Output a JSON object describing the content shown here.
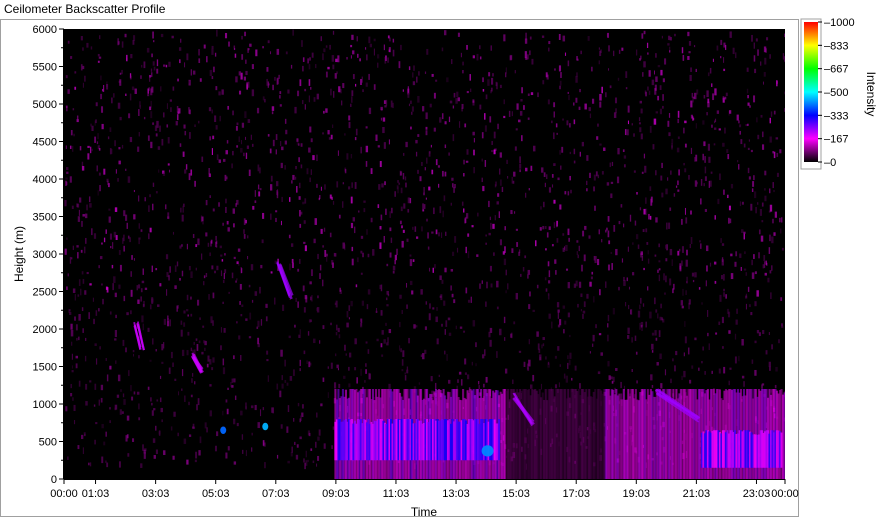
{
  "window": {
    "title": "Ceilometer Backscatter Profile"
  },
  "chart_data": {
    "type": "heatmap",
    "title": "Ceilometer Backscatter Profile",
    "xlabel": "Time",
    "ylabel": "Height (m)",
    "x_ticks": [
      "00:00",
      "01:03",
      "03:03",
      "05:03",
      "07:03",
      "09:03",
      "11:03",
      "13:03",
      "15:03",
      "17:03",
      "19:03",
      "21:03",
      "23:03",
      "00:00"
    ],
    "x_range_hours": [
      0,
      24
    ],
    "y_ticks": [
      "0",
      "500",
      "1000",
      "1500",
      "2000",
      "2500",
      "3000",
      "3500",
      "4000",
      "4500",
      "5000",
      "5500",
      "6000"
    ],
    "ylim": [
      0,
      6000
    ],
    "colorbar": {
      "label": "Intensity",
      "ticks": [
        "0",
        "167",
        "333",
        "500",
        "667",
        "833",
        "1000"
      ],
      "range": [
        0,
        1000
      ],
      "colors": [
        "#000000",
        "#ff00ff",
        "#0000ff",
        "#00ffff",
        "#00ff00",
        "#ffff00",
        "#ff0000"
      ]
    },
    "background_color": "#000000",
    "features": [
      {
        "name": "boundary layer",
        "t_start": 9.0,
        "t_end": 14.7,
        "h_low": 0,
        "h_high": 1200,
        "intensity": 220
      },
      {
        "name": "boundary layer",
        "t_start": 14.7,
        "t_end": 18.0,
        "h_low": 0,
        "h_high": 1200,
        "intensity": 60
      },
      {
        "name": "boundary layer",
        "t_start": 18.0,
        "t_end": 24.0,
        "h_low": 0,
        "h_high": 1200,
        "intensity": 200
      },
      {
        "name": "aerosol layer",
        "t_start": 9.0,
        "t_end": 14.5,
        "h_low": 250,
        "h_high": 800,
        "intensity": 300
      },
      {
        "name": "aerosol layer",
        "t_start": 21.2,
        "t_end": 23.9,
        "h_low": 150,
        "h_high": 650,
        "intensity": 280
      },
      {
        "name": "cloud",
        "t_start": 5.2,
        "t_end": 5.4,
        "h_low": 600,
        "h_high": 700,
        "intensity": 400
      },
      {
        "name": "cloud",
        "t_start": 6.6,
        "t_end": 6.8,
        "h_low": 650,
        "h_high": 750,
        "intensity": 450
      },
      {
        "name": "cloud",
        "t_start": 13.9,
        "t_end": 14.3,
        "h_low": 300,
        "h_high": 450,
        "intensity": 420
      },
      {
        "name": "streak",
        "t_start": 7.15,
        "t_end": 7.55,
        "h_low": 2400,
        "h_high": 2900,
        "intensity": 230
      },
      {
        "name": "streak",
        "t_start": 2.4,
        "t_end": 2.6,
        "h_low": 1700,
        "h_high": 2100,
        "intensity": 200
      },
      {
        "name": "streak",
        "t_start": 4.3,
        "t_end": 4.6,
        "h_low": 1400,
        "h_high": 1700,
        "intensity": 200
      },
      {
        "name": "streak",
        "t_start": 15.0,
        "t_end": 15.6,
        "h_low": 700,
        "h_high": 1150,
        "intensity": 220
      },
      {
        "name": "streak",
        "t_start": 19.7,
        "t_end": 21.1,
        "h_low": 750,
        "h_high": 1200,
        "intensity": 230
      }
    ]
  }
}
